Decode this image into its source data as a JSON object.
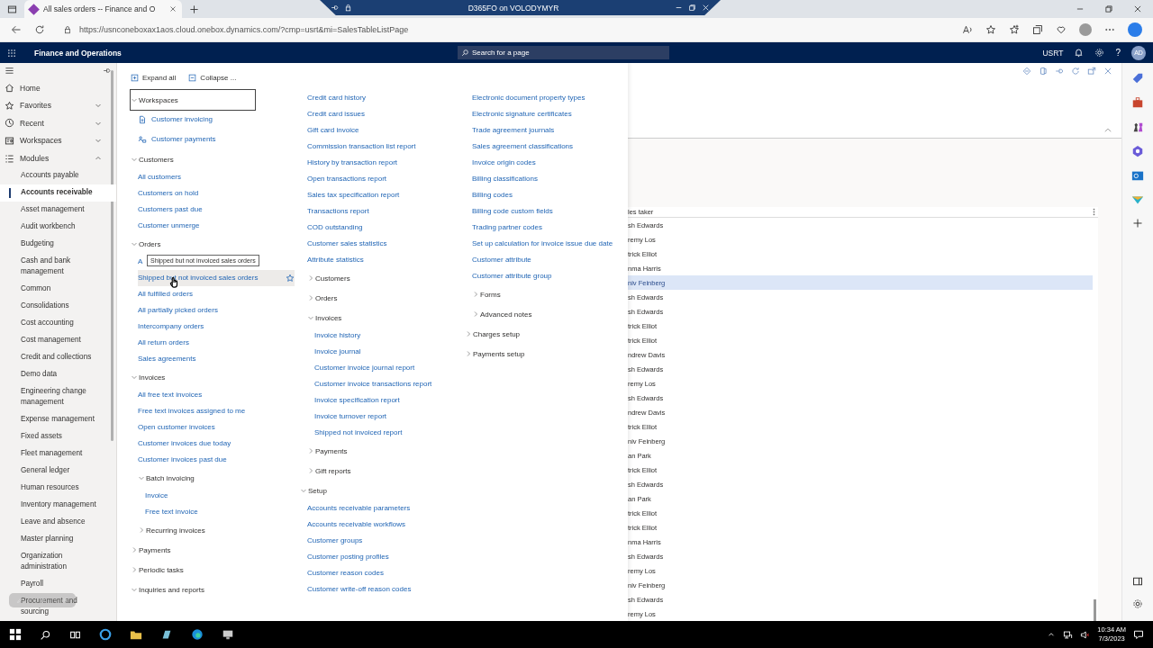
{
  "browser": {
    "tab_title": "All sales orders -- Finance and O",
    "remote_title": "D365FO on VOLODYMYR",
    "url": "https://usnconeboxax1aos.cloud.onebox.dynamics.com/?cmp=usrt&mi=SalesTableListPage"
  },
  "app_bar": {
    "title": "Finance and Operations",
    "search_placeholder": "Search for a page",
    "company": "USRT",
    "help": "?",
    "avatar": "AD"
  },
  "nav": {
    "items": [
      {
        "kind": "home",
        "label": "Home"
      },
      {
        "kind": "favorites",
        "label": "Favorites",
        "expanded": false
      },
      {
        "kind": "recent",
        "label": "Recent",
        "expanded": false
      },
      {
        "kind": "workspaces",
        "label": "Workspaces",
        "expanded": false
      },
      {
        "kind": "modules",
        "label": "Modules",
        "expanded": true
      }
    ],
    "modules": [
      {
        "label": "Accounts payable",
        "selected": false
      },
      {
        "label": "Accounts receivable",
        "selected": true
      },
      {
        "label": "Asset management",
        "selected": false
      },
      {
        "label": "Audit workbench",
        "selected": false
      },
      {
        "label": "Budgeting",
        "selected": false
      },
      {
        "label": "Cash and bank management",
        "selected": false
      },
      {
        "label": "Common",
        "selected": false
      },
      {
        "label": "Consolidations",
        "selected": false
      },
      {
        "label": "Cost accounting",
        "selected": false
      },
      {
        "label": "Cost management",
        "selected": false
      },
      {
        "label": "Credit and collections",
        "selected": false
      },
      {
        "label": "Demo data",
        "selected": false
      },
      {
        "label": "Engineering change management",
        "selected": false
      },
      {
        "label": "Expense management",
        "selected": false
      },
      {
        "label": "Fixed assets",
        "selected": false
      },
      {
        "label": "Fleet management",
        "selected": false
      },
      {
        "label": "General ledger",
        "selected": false
      },
      {
        "label": "Human resources",
        "selected": false
      },
      {
        "label": "Inventory management",
        "selected": false
      },
      {
        "label": "Leave and absence",
        "selected": false
      },
      {
        "label": "Master planning",
        "selected": false
      },
      {
        "label": "Organization administration",
        "selected": false
      },
      {
        "label": "Payroll",
        "selected": false
      },
      {
        "label": "Procurement and sourcing",
        "selected": false
      }
    ]
  },
  "menu": {
    "toolbar": [
      {
        "kind": "expand",
        "label": "Expand all"
      },
      {
        "kind": "collapse",
        "label": "Collapse ..."
      }
    ],
    "columns": [
      {
        "nodes": [
          {
            "kind": "group",
            "label": "Workspaces",
            "expanded": true,
            "focused": true,
            "children": [
              {
                "kind": "workspace",
                "label": "Customer invoicing"
              },
              {
                "kind": "workspace",
                "label": "Customer payments"
              }
            ]
          },
          {
            "kind": "group",
            "label": "Customers",
            "expanded": true,
            "children": [
              {
                "kind": "link",
                "label": "All customers"
              },
              {
                "kind": "link",
                "label": "Customers on hold"
              },
              {
                "kind": "link",
                "label": "Customers past due"
              },
              {
                "kind": "link",
                "label": "Customer unmerge"
              }
            ]
          },
          {
            "kind": "group",
            "label": "Orders",
            "expanded": true,
            "children": [
              {
                "kind": "link",
                "label": "A"
              },
              {
                "kind": "link",
                "label": "Shipped but not invoiced sales orders",
                "tooltip": "Shipped but not invoiced sales orders"
              },
              {
                "kind": "link",
                "label": "All fulfilled orders"
              },
              {
                "kind": "link",
                "label": "All partially picked orders"
              },
              {
                "kind": "link",
                "label": "Intercompany orders"
              },
              {
                "kind": "link",
                "label": "All return orders"
              },
              {
                "kind": "link",
                "label": "Sales agreements"
              }
            ]
          },
          {
            "kind": "group",
            "label": "Invoices",
            "expanded": true,
            "children": [
              {
                "kind": "link",
                "label": "All free text invoices"
              },
              {
                "kind": "link",
                "label": "Free text invoices assigned to me"
              },
              {
                "kind": "link",
                "label": "Open customer invoices"
              },
              {
                "kind": "link",
                "label": "Customer invoices due today"
              },
              {
                "kind": "link",
                "label": "Customer invoices past due"
              },
              {
                "kind": "group",
                "label": "Batch invoicing",
                "expanded": true,
                "children": [
                  {
                    "kind": "link",
                    "label": "Invoice"
                  },
                  {
                    "kind": "link",
                    "label": "Free text invoice"
                  }
                ]
              },
              {
                "kind": "group",
                "label": "Recurring invoices",
                "expanded": false
              }
            ]
          },
          {
            "kind": "group",
            "label": "Payments",
            "expanded": false
          },
          {
            "kind": "group",
            "label": "Periodic tasks",
            "expanded": false
          },
          {
            "kind": "group",
            "label": "Inquiries and reports",
            "expanded": true
          }
        ]
      },
      {
        "nodes": [
          {
            "kind": "continued",
            "children": [
              {
                "kind": "link",
                "label": "Credit card history"
              },
              {
                "kind": "link",
                "label": "Credit card issues"
              },
              {
                "kind": "link",
                "label": "Gift card invoice"
              },
              {
                "kind": "link",
                "label": "Commission transaction list report"
              },
              {
                "kind": "link",
                "label": "History by transaction report"
              },
              {
                "kind": "link",
                "label": "Open transactions report"
              },
              {
                "kind": "link",
                "label": "Sales tax specification report"
              },
              {
                "kind": "link",
                "label": "Transactions report"
              },
              {
                "kind": "link",
                "label": "COD outstanding"
              },
              {
                "kind": "link",
                "label": "Customer sales statistics"
              },
              {
                "kind": "link",
                "label": "Attribute statistics"
              },
              {
                "kind": "group",
                "label": "Customers",
                "expanded": false
              },
              {
                "kind": "group",
                "label": "Orders",
                "expanded": false
              },
              {
                "kind": "group",
                "label": "Invoices",
                "expanded": true,
                "children": [
                  {
                    "kind": "link",
                    "label": "Invoice history"
                  },
                  {
                    "kind": "link",
                    "label": "Invoice journal"
                  },
                  {
                    "kind": "link",
                    "label": "Customer invoice journal report"
                  },
                  {
                    "kind": "link",
                    "label": "Customer invoice transactions report"
                  },
                  {
                    "kind": "link",
                    "label": "Invoice specification report"
                  },
                  {
                    "kind": "link",
                    "label": "Invoice turnover report"
                  },
                  {
                    "kind": "link",
                    "label": "Shipped not invoiced report"
                  }
                ]
              },
              {
                "kind": "group",
                "label": "Payments",
                "expanded": false
              },
              {
                "kind": "group",
                "label": "Gift reports",
                "expanded": false
              }
            ]
          },
          {
            "kind": "group",
            "label": "Setup",
            "expanded": true,
            "children": [
              {
                "kind": "link",
                "label": "Accounts receivable parameters"
              },
              {
                "kind": "link",
                "label": "Accounts receivable workflows"
              },
              {
                "kind": "link",
                "label": "Customer groups"
              },
              {
                "kind": "link",
                "label": "Customer posting profiles"
              },
              {
                "kind": "link",
                "label": "Customer reason codes"
              },
              {
                "kind": "link",
                "label": "Customer write-off reason codes"
              }
            ]
          }
        ]
      },
      {
        "nodes": [
          {
            "kind": "continued",
            "children": [
              {
                "kind": "link",
                "label": "Electronic document property types"
              },
              {
                "kind": "link",
                "label": "Electronic signature certificates"
              },
              {
                "kind": "link",
                "label": "Trade agreement journals"
              },
              {
                "kind": "link",
                "label": "Sales agreement classifications"
              },
              {
                "kind": "link",
                "label": "Invoice origin codes"
              },
              {
                "kind": "link",
                "label": "Billing classifications"
              },
              {
                "kind": "link",
                "label": "Billing codes"
              },
              {
                "kind": "link",
                "label": "Billing code custom fields"
              },
              {
                "kind": "link",
                "label": "Trading partner codes"
              },
              {
                "kind": "link",
                "label": "Set up calculation for invoice issue due date"
              },
              {
                "kind": "link",
                "label": "Customer attribute"
              },
              {
                "kind": "link",
                "label": "Customer attribute group"
              },
              {
                "kind": "group",
                "label": "Forms",
                "expanded": false
              },
              {
                "kind": "group",
                "label": "Advanced notes",
                "expanded": false
              }
            ]
          },
          {
            "kind": "group",
            "label": "Charges setup",
            "expanded": false
          },
          {
            "kind": "group",
            "label": "Payments setup",
            "expanded": false
          }
        ]
      }
    ]
  },
  "page": {
    "column_header": "les taker",
    "rows": [
      {
        "sales_taker": "sh Edwards",
        "selected": false
      },
      {
        "sales_taker": "remy Los",
        "selected": false
      },
      {
        "sales_taker": "trick Elliot",
        "selected": false
      },
      {
        "sales_taker": "nma Harris",
        "selected": false
      },
      {
        "sales_taker": "niv Feinberg",
        "selected": true
      },
      {
        "sales_taker": "sh Edwards",
        "selected": false
      },
      {
        "sales_taker": "sh Edwards",
        "selected": false
      },
      {
        "sales_taker": "trick Elliot",
        "selected": false
      },
      {
        "sales_taker": "trick Elliot",
        "selected": false
      },
      {
        "sales_taker": "ndrew Davis",
        "selected": false
      },
      {
        "sales_taker": "sh Edwards",
        "selected": false
      },
      {
        "sales_taker": "remy Los",
        "selected": false
      },
      {
        "sales_taker": "sh Edwards",
        "selected": false
      },
      {
        "sales_taker": "ndrew Davis",
        "selected": false
      },
      {
        "sales_taker": "trick Elliot",
        "selected": false
      },
      {
        "sales_taker": "niv Feinberg",
        "selected": false
      },
      {
        "sales_taker": "an Park",
        "selected": false
      },
      {
        "sales_taker": "trick Elliot",
        "selected": false
      },
      {
        "sales_taker": "sh Edwards",
        "selected": false
      },
      {
        "sales_taker": "an Park",
        "selected": false
      },
      {
        "sales_taker": "trick Elliot",
        "selected": false
      },
      {
        "sales_taker": "trick Elliot",
        "selected": false
      },
      {
        "sales_taker": "nma Harris",
        "selected": false
      },
      {
        "sales_taker": "sh Edwards",
        "selected": false
      },
      {
        "sales_taker": "remy Los",
        "selected": false
      },
      {
        "sales_taker": "niv Feinberg",
        "selected": false
      },
      {
        "sales_taker": "sh Edwards",
        "selected": false
      },
      {
        "sales_taker": "remy Los",
        "selected": false
      }
    ]
  },
  "taskbar": {
    "time": "10:34 AM",
    "date": "7/3/2023"
  }
}
